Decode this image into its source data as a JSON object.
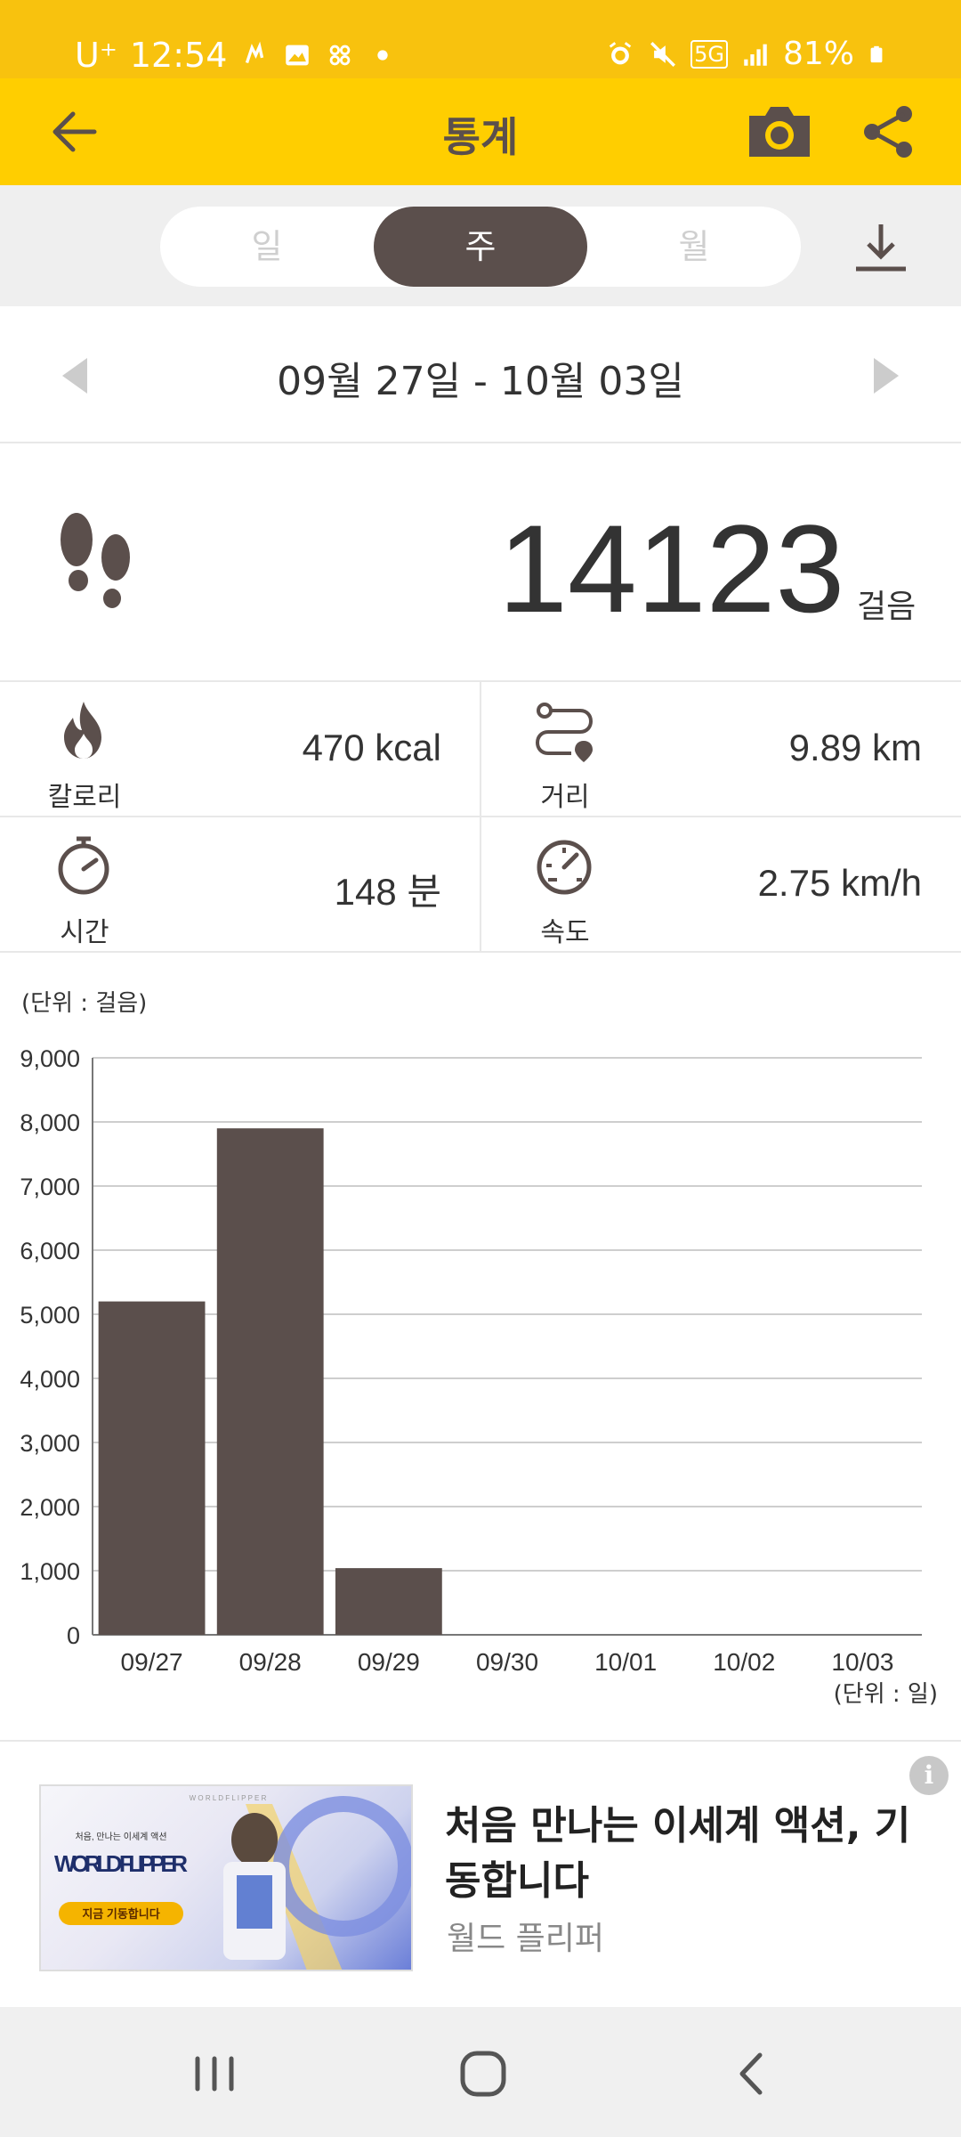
{
  "status_bar": {
    "carrier": "U⁺",
    "time": "12:54",
    "network": "5G",
    "battery": "81%"
  },
  "app_bar": {
    "title": "통계"
  },
  "period_tabs": {
    "day": "일",
    "week": "주",
    "month": "월",
    "selected": "주"
  },
  "date_range": {
    "label": "09월 27일 - 10월 03일"
  },
  "steps": {
    "value": "14123",
    "unit": "걸음"
  },
  "stats": {
    "calories": {
      "label": "칼로리",
      "value": "470 kcal",
      "icon": "flame-icon"
    },
    "distance": {
      "label": "거리",
      "value": "9.89 km",
      "icon": "route-icon"
    },
    "time": {
      "label": "시간",
      "value": "148 분",
      "icon": "stopwatch-icon"
    },
    "speed": {
      "label": "속도",
      "value": "2.75 km/h",
      "icon": "speedometer-icon"
    }
  },
  "chart_data": {
    "type": "bar",
    "unit_y_label": "(단위 : 걸음)",
    "unit_x_label": "(단위 : 일)",
    "categories": [
      "09/27",
      "09/28",
      "09/29",
      "09/30",
      "10/01",
      "10/02",
      "10/03"
    ],
    "values": [
      5200,
      7900,
      1040,
      0,
      0,
      0,
      0
    ],
    "y_ticks": [
      "0",
      "1,000",
      "2,000",
      "3,000",
      "4,000",
      "5,000",
      "6,000",
      "7,000",
      "8,000",
      "9,000"
    ],
    "ylim": [
      0,
      9000
    ],
    "grid": true,
    "bar_color": "#5B4F4C"
  },
  "ad": {
    "title": "처음 만나는 이세계 액션, 기동합니다",
    "subtitle": "월드 플리퍼",
    "info": "i",
    "image_text": {
      "top": "W O R L D   F L I P P E R",
      "tagline": "처음, 만나는 이세계 액션",
      "logo": "WORLD FLIPPER",
      "button": "지금 기동합니다"
    }
  },
  "colors": {
    "brand_yellow": "#FFCE00",
    "status_yellow": "#F8C20E",
    "accent_brown": "#5B4F4C"
  }
}
